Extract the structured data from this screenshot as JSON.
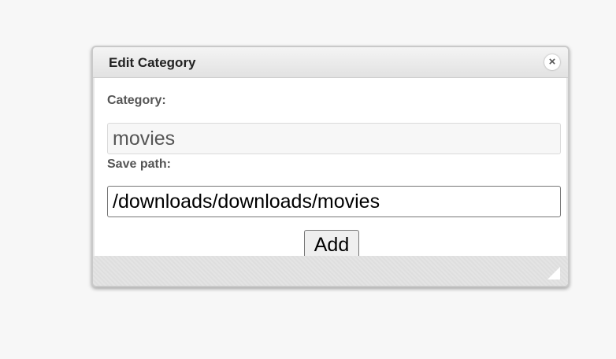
{
  "dialog": {
    "title": "Edit Category",
    "close_icon": "close-icon",
    "category_label": "Category:",
    "category_value": "movies",
    "save_path_label": "Save path:",
    "save_path_value": "/downloads/downloads/movies",
    "add_label": "Add",
    "resize_icon": "resize-grip-icon"
  },
  "colors": {
    "page_background": "#f7f7f7",
    "titlebar": "#e9e9e9",
    "content_background": "#ffffff",
    "label_text": "#555555",
    "disabled_field": "#f7f7f7"
  }
}
